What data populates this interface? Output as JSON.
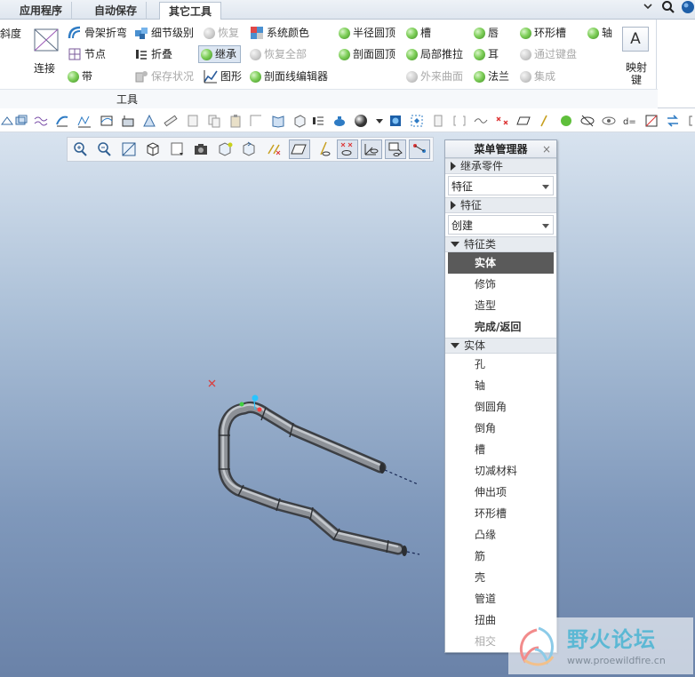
{
  "tabs": [
    {
      "label": "应用程序",
      "active": false
    },
    {
      "label": "自动保存",
      "active": false
    },
    {
      "label": "其它工具",
      "active": true
    }
  ],
  "ribbon": {
    "col0": {
      "partial_label": "斜度",
      "connect_label": "连接"
    },
    "col1": [
      "骨架折弯",
      "节点",
      "带"
    ],
    "col2": [
      "细节级别",
      "折叠",
      "保存状况"
    ],
    "col3": [
      "恢复",
      "继承",
      "图形"
    ],
    "col3b": [
      "恢复全部",
      "剖面线编辑器"
    ],
    "col4": [
      "系统颜色"
    ],
    "col5": [
      "半径圆顶",
      "剖面圆顶",
      "外来曲面"
    ],
    "col6": [
      "槽",
      "局部推拉",
      "法兰"
    ],
    "col7": [
      "唇",
      "耳"
    ],
    "col8": [
      "环形槽",
      "通过键盘",
      "集成"
    ],
    "col9": [
      "轴"
    ],
    "map_key": {
      "glyph": "A",
      "label": "映射键"
    },
    "group_label": "工具"
  },
  "menu_manager": {
    "title": "菜单管理器",
    "close": "×",
    "inherit_header": "继承零件",
    "inherit_value": "特征",
    "feature_header": "特征",
    "feature_value": "创建",
    "class_header": "特征类",
    "class_items": [
      "实体",
      "修饰",
      "造型",
      "完成/返回"
    ],
    "solid_header": "实体",
    "solid_items": [
      "孔",
      "轴",
      "倒圆角",
      "倒角",
      "槽",
      "切减材料",
      "伸出项",
      "环形槽",
      "凸缘",
      "筋",
      "壳",
      "管道",
      "扭曲",
      "相交"
    ]
  },
  "watermark": {
    "title": "野火论坛",
    "url": "www.proewildfire.cn"
  },
  "colors": {
    "accent_green": "#5fbf3b",
    "selection": "#5a5a5a",
    "pipe": "#6d6f73"
  }
}
